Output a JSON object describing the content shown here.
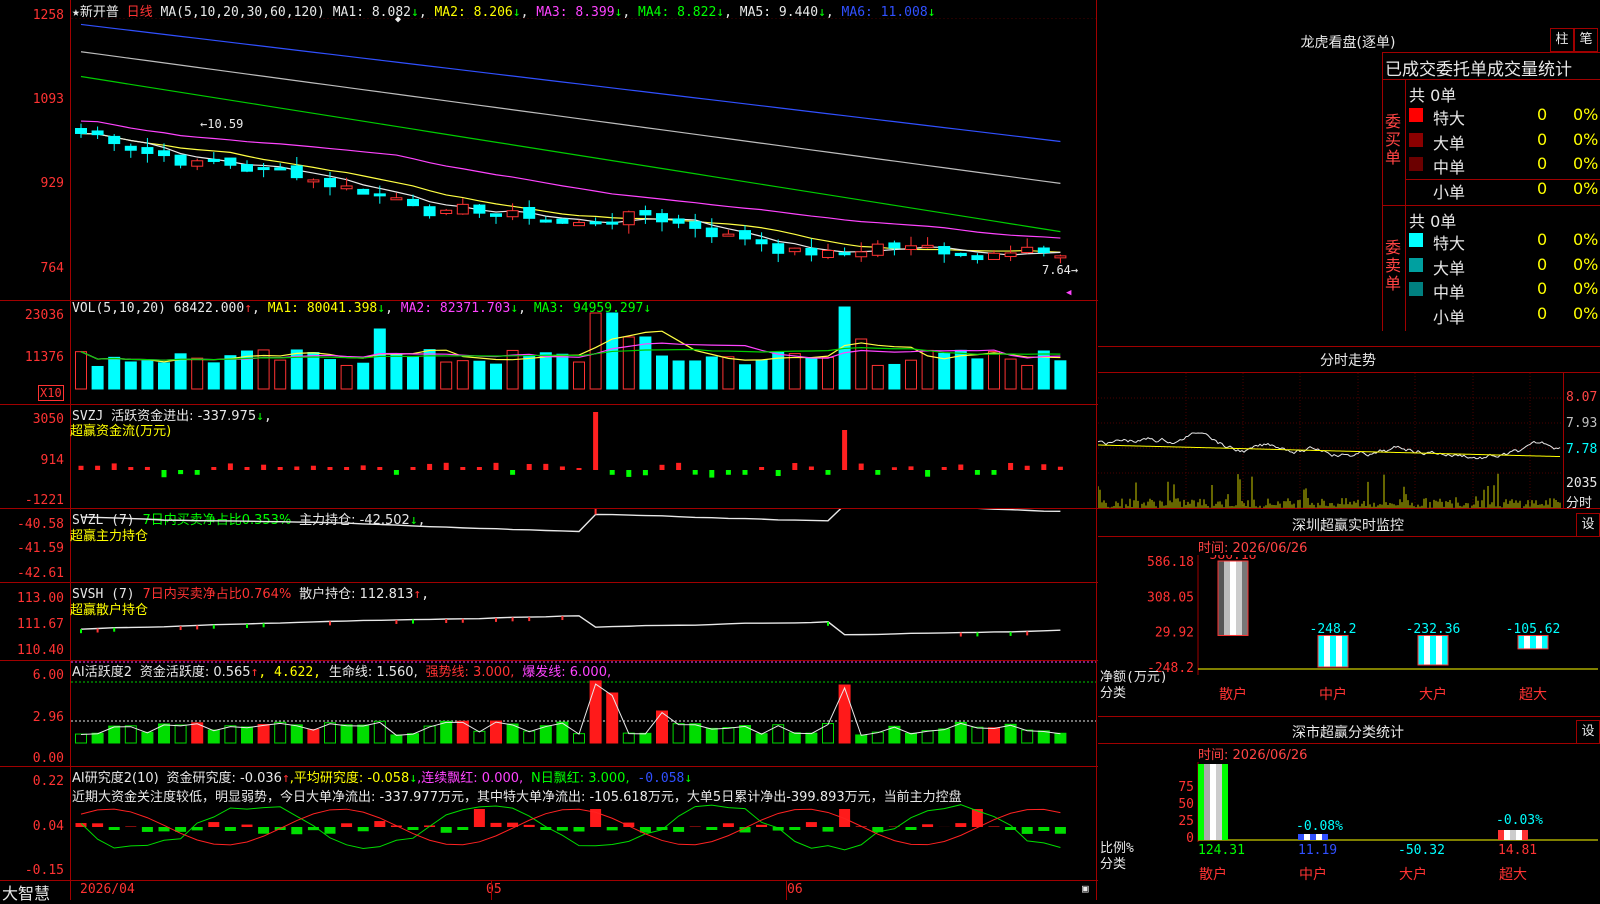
{
  "stock": {
    "star": "★",
    "name": "新开普",
    "period": "日线"
  },
  "main_header": {
    "ma_label": "MA(5,10,20,30,60,120)",
    "ma1": "MA1: 8.082",
    "ma1_arrow": "↓",
    "ma2": "MA2: 8.206",
    "ma2_arrow": "↓",
    "ma3": "MA3: 8.399",
    "ma3_arrow": "↓",
    "ma4": "MA4: 8.822",
    "ma4_arrow": "↓",
    "ma5": "MA5: 9.440",
    "ma5_arrow": "↓",
    "ma6": "MA6: 11.008",
    "ma6_arrow": "↓"
  },
  "main_axis": [
    "1258",
    "1093",
    "929",
    "764"
  ],
  "main_annotations": {
    "high": "10.59",
    "low": "7.64"
  },
  "vol_header": {
    "label": "VOL(5,10,20)",
    "value": "68422.000",
    "arrow": "↑",
    "ma1": "MA1: 80041.398",
    "ma1_arrow": "↓",
    "ma2": "MA2: 82371.703",
    "ma2_arrow": "↓",
    "ma3": "MA3: 94959.297",
    "ma3_arrow": "↓"
  },
  "vol_axis": [
    "23036",
    "11376"
  ],
  "vol_unit": "X10",
  "svzj_header": {
    "label": "SVZJ",
    "text": "活跃资金进出: -337.975",
    "arrow": "↓",
    "suffix": ",",
    "sub": "超赢资金流(万元)"
  },
  "svzj_axis": [
    "3050",
    "914",
    "-1221"
  ],
  "svzl_header": {
    "label": "SVZL (7)",
    "text1": "7日内买卖净占比0.353%",
    "text2": "主力持仓: -42.502",
    "arrow": "↓",
    "suffix": ",",
    "sub": "超赢主力持仓"
  },
  "svzl_axis": [
    "-40.58",
    "-41.59",
    "-42.61"
  ],
  "svsh_header": {
    "label": "SVSH (7)",
    "text1": "7日内买卖净占比0.764%",
    "text2": "散户持仓: 112.813",
    "arrow": "↑",
    "suffix": ",",
    "sub": "超赢散户持仓"
  },
  "svsh_axis": [
    "113.00",
    "111.67",
    "110.40"
  ],
  "ai1_header": {
    "label": "AI活跃度2",
    "text1": "资金活跃度: 0.565",
    "a1": "↑",
    "text2": ", 4.622,",
    "text3": "生命线: 1.560,",
    "text4": "强势线: 3.000,",
    "text5": "爆发线: 6.000,"
  },
  "ai1_axis": [
    "6.00",
    "2.96",
    "0.00"
  ],
  "ai2_header": {
    "label": "AI研究度2(10)",
    "text1": "资金研究度: -0.036",
    "a1": "↑",
    "text2": ",平均研究度: -0.058",
    "a2": "↓",
    "text3": ",连续飘红: 0.000,",
    "text4": "N日飘红: 3.000,",
    "text5": "-0.058",
    "a5": "↓"
  },
  "ai2_comment": "近期大资金关注度较低，明显弱势，今日大单净流出: -337.977万元，其中特大单净流出: -105.618万元，大单5日累计净出-399.893万元，当前主力控盘",
  "ai2_axis": [
    "0.22",
    "0.04",
    "-0.15"
  ],
  "bottom": {
    "app": "大智慧",
    "date": "2026/04",
    "m1": "05",
    "m2": "06"
  },
  "right": {
    "dragon_title": "龙虎看盘(逐单)",
    "btn_zhu": "柱",
    "btn_bi": "笔",
    "stats_title": "已成交委托单成交量统计",
    "buy_side_label": "委买单",
    "sell_side_label": "委卖单",
    "buy_total": "共 0单",
    "sell_total": "共 0单",
    "buy_rows": [
      {
        "label": "特大",
        "count": "0",
        "pct": "0%",
        "color": "#ff0000"
      },
      {
        "label": "大单",
        "count": "0",
        "pct": "0%",
        "color": "#8b0000"
      },
      {
        "label": "中单",
        "count": "0",
        "pct": "0%",
        "color": "#6b0000"
      },
      {
        "label": "小单",
        "count": "0",
        "pct": "0%",
        "color": ""
      }
    ],
    "sell_rows": [
      {
        "label": "特大",
        "count": "0",
        "pct": "0%",
        "color": "#00ffff"
      },
      {
        "label": "大单",
        "count": "0",
        "pct": "0%",
        "color": "#00a0a0"
      },
      {
        "label": "中单",
        "count": "0",
        "pct": "0%",
        "color": "#008080"
      },
      {
        "label": "小单",
        "count": "0",
        "pct": "0%",
        "color": ""
      }
    ],
    "intraday_title": "分时走势",
    "intraday_axis": [
      "8.07",
      "7.93",
      "7.78",
      "2035"
    ],
    "intraday_axis_unit": "分时",
    "monitor_title": "深圳超赢实时监控",
    "monitor_btn": "设",
    "monitor_time": "时间: 2026/06/26",
    "monitor_axis": [
      "586.18",
      "308.05",
      "29.92",
      "-248.2"
    ],
    "monitor_ylabel": "净额(万元)",
    "monitor_xlabel": "分类",
    "monitor_values": [
      "586.18",
      "-248.2",
      "-232.36",
      "-105.62"
    ],
    "monitor_cats": [
      "散户",
      "中户",
      "大户",
      "超大"
    ],
    "class_title": "深市超赢分类统计",
    "class_btn": "设",
    "class_time": "时间: 2026/06/26",
    "class_axis": [
      "75",
      "50",
      "25",
      "0"
    ],
    "class_ylabel": "比例%",
    "class_xlabel": "分类",
    "class_labels": [
      "-0.08%",
      "-0.03%"
    ],
    "class_values": [
      "124.31",
      "11.19",
      "-50.32",
      "14.81"
    ],
    "class_cats": [
      "散户",
      "中户",
      "大户",
      "超大"
    ]
  },
  "chart_data": {
    "type": "bar",
    "title": "深圳超赢实时监控",
    "categories": [
      "散户",
      "中户",
      "大户",
      "超大"
    ],
    "series": [
      {
        "name": "净额(万元)",
        "values": [
          586.18,
          -248.2,
          -232.36,
          -105.62
        ]
      }
    ],
    "ylim": [
      -248.2,
      586.18
    ]
  }
}
